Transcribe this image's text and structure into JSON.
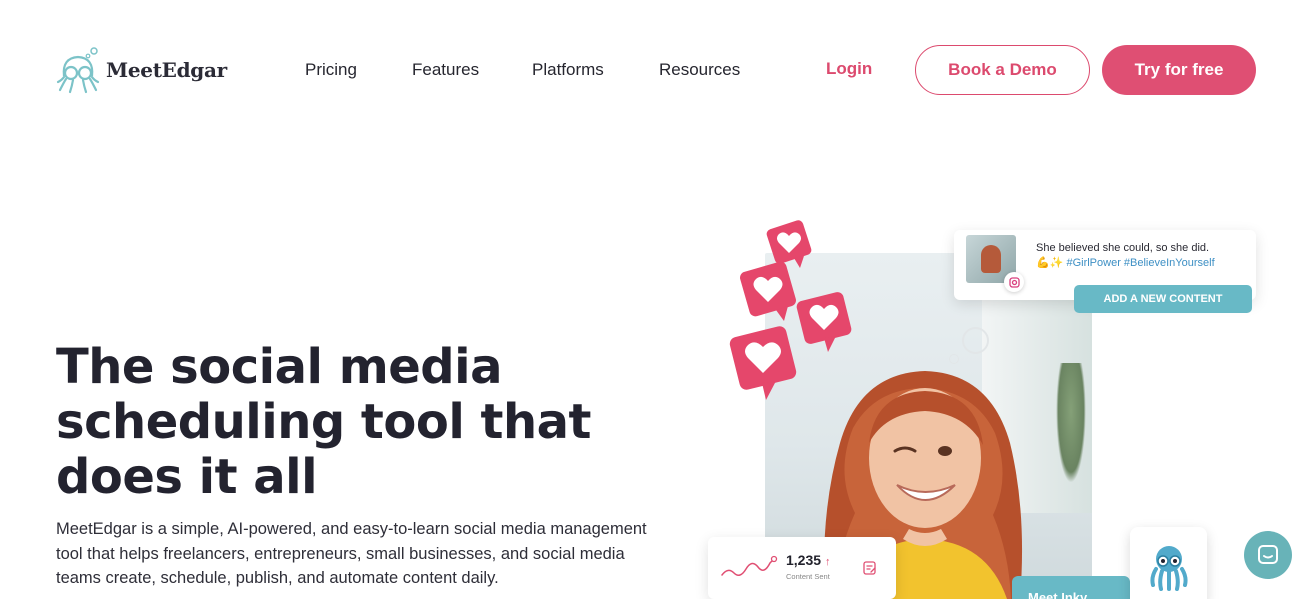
{
  "brand": {
    "name": "MeetEdgar"
  },
  "nav": {
    "items": [
      {
        "label": "Pricing"
      },
      {
        "label": "Features"
      },
      {
        "label": "Platforms"
      },
      {
        "label": "Resources"
      }
    ],
    "login_label": "Login",
    "demo_label": "Book a Demo",
    "try_label": "Try for free"
  },
  "hero": {
    "title": "The social media scheduling tool that does it all",
    "description": "MeetEdgar is a simple, AI-powered, and easy-to-learn social media management tool that helps freelancers, entrepreneurs, small businesses, and social media teams create, schedule, publish, and automate content daily."
  },
  "visual": {
    "post_text": "She believed she could, so she did.",
    "post_tags": "💪✨ #GirlPower #BelieveInYourself",
    "add_content_label": "ADD A NEW CONTENT",
    "stats_value": "1,235",
    "stats_label": "Content Sent",
    "inky_label": "Meet Inky"
  },
  "colors": {
    "accent": "#df4f73",
    "teal": "#68b9c6",
    "text": "#23232f"
  }
}
